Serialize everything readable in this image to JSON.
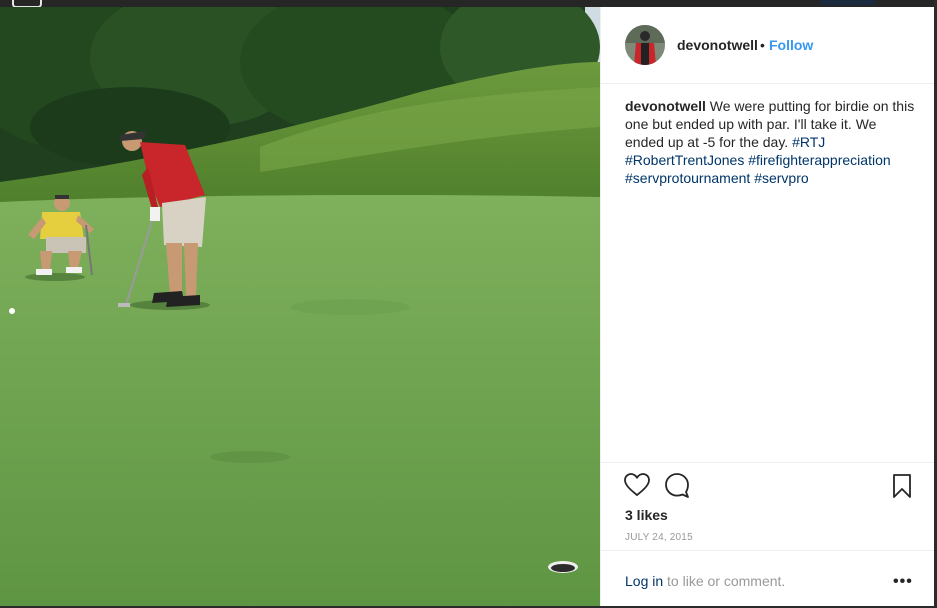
{
  "post": {
    "username": "devonotwell",
    "separator": "•",
    "follow_label": "Follow",
    "caption_user": "devonotwell",
    "caption_text": " We were putting for birdie on this one but ended up with par. I'll take it. We ended up at -5 for the day. ",
    "hashtags": [
      "#RTJ",
      "#RobertTrentJones",
      "#firefighterappreciation",
      "#servprotournament",
      "#servpro"
    ],
    "likes": "3 likes",
    "date": "JULY 24, 2015",
    "login_link": "Log in",
    "login_rest": " to like or comment.",
    "more_label": "•••"
  },
  "icons": {
    "like": "heart-icon",
    "comment": "comment-icon",
    "save": "bookmark-icon",
    "more": "more-options-icon"
  },
  "colors": {
    "link_blue": "#3897f0",
    "hashtag": "#003569",
    "grass": "#6da04f",
    "shirt_red": "#c8262b",
    "shirt_yellow": "#e8d44a"
  }
}
